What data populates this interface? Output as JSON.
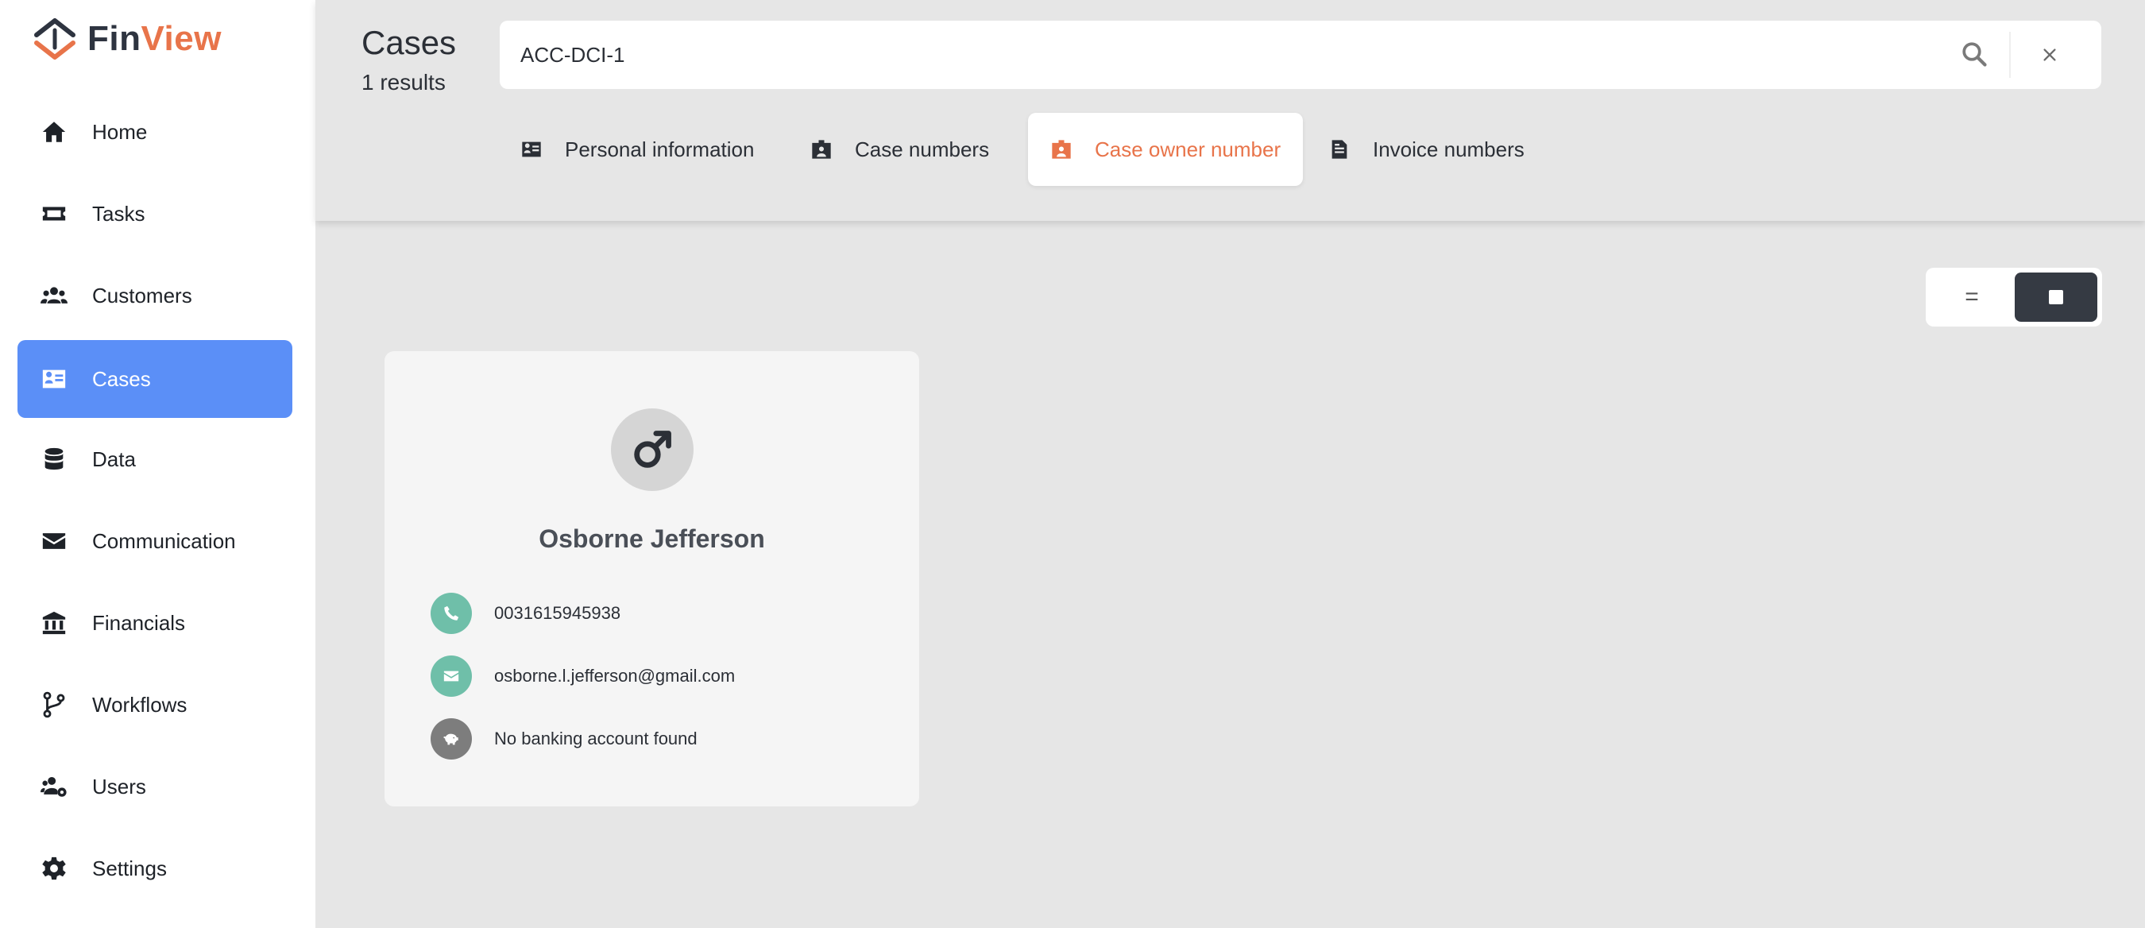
{
  "app": {
    "logo_part1": "Fin",
    "logo_part2": "View",
    "brand_colors": {
      "primary": "#e8744a",
      "dark": "#2e3440",
      "active_nav": "#5b8ff7"
    }
  },
  "sidebar": {
    "items": [
      {
        "label": "Home",
        "icon": "home-icon",
        "active": false
      },
      {
        "label": "Tasks",
        "icon": "ticket-icon",
        "active": false
      },
      {
        "label": "Customers",
        "icon": "users-icon",
        "active": false
      },
      {
        "label": "Cases",
        "icon": "id-card-icon",
        "active": true
      },
      {
        "label": "Data",
        "icon": "database-icon",
        "active": false
      },
      {
        "label": "Communication",
        "icon": "envelope-icon",
        "active": false
      },
      {
        "label": "Financials",
        "icon": "bank-icon",
        "active": false
      },
      {
        "label": "Workflows",
        "icon": "branch-icon",
        "active": false
      },
      {
        "label": "Users",
        "icon": "users-gear-icon",
        "active": false
      },
      {
        "label": "Settings",
        "icon": "gear-icon",
        "active": false
      }
    ]
  },
  "header": {
    "title": "Cases",
    "result_count": "1 results",
    "search": {
      "value": "ACC-DCI-1",
      "placeholder": ""
    },
    "tabs": [
      {
        "label": "Personal information",
        "icon": "address-card-icon",
        "active": false
      },
      {
        "label": "Case numbers",
        "icon": "id-badge-icon",
        "active": false
      },
      {
        "label": "Case owner number",
        "icon": "id-badge-icon",
        "active": true
      },
      {
        "label": "Invoice numbers",
        "icon": "file-invoice-icon",
        "active": false
      }
    ]
  },
  "view_toggle": {
    "list_symbol": "=",
    "selected": "grid"
  },
  "results": [
    {
      "name": "Osborne Jefferson",
      "gender_icon": "male-icon",
      "phone": "0031615945938",
      "email": "osborne.l.jefferson@gmail.com",
      "bank": "No banking account found"
    }
  ]
}
